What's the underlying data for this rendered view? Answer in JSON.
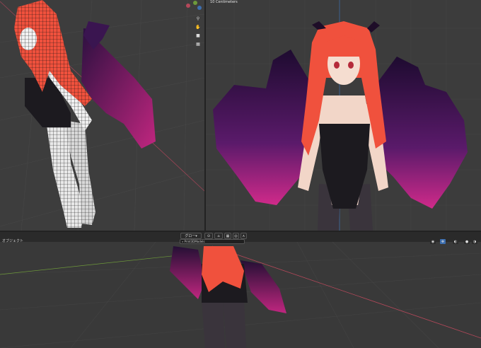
{
  "viewport_right": {
    "scale_label": "10 Centimeters"
  },
  "viewport_left": {
    "nav_icons": [
      "zoom-icon",
      "hand-pan-icon",
      "camera-icon",
      "grid-icon"
    ]
  },
  "viewport_bottom": {
    "header_label": "オブジェクト",
    "toolbar": {
      "global_label": "グロー",
      "search_value": "Print3DModels"
    }
  },
  "colors": {
    "viewport_bg": "#3c3c3c",
    "grid_line": "#4a4a4a",
    "axis_x": "#b5485a",
    "axis_y": "#6e9a3a",
    "axis_z": "#3d6fb0",
    "hair": "#f0513d",
    "wing_dark": "#2b1040",
    "wing_bright": "#c0267f",
    "skin": "#f2d6c8",
    "suit": "#1c1a1f"
  }
}
